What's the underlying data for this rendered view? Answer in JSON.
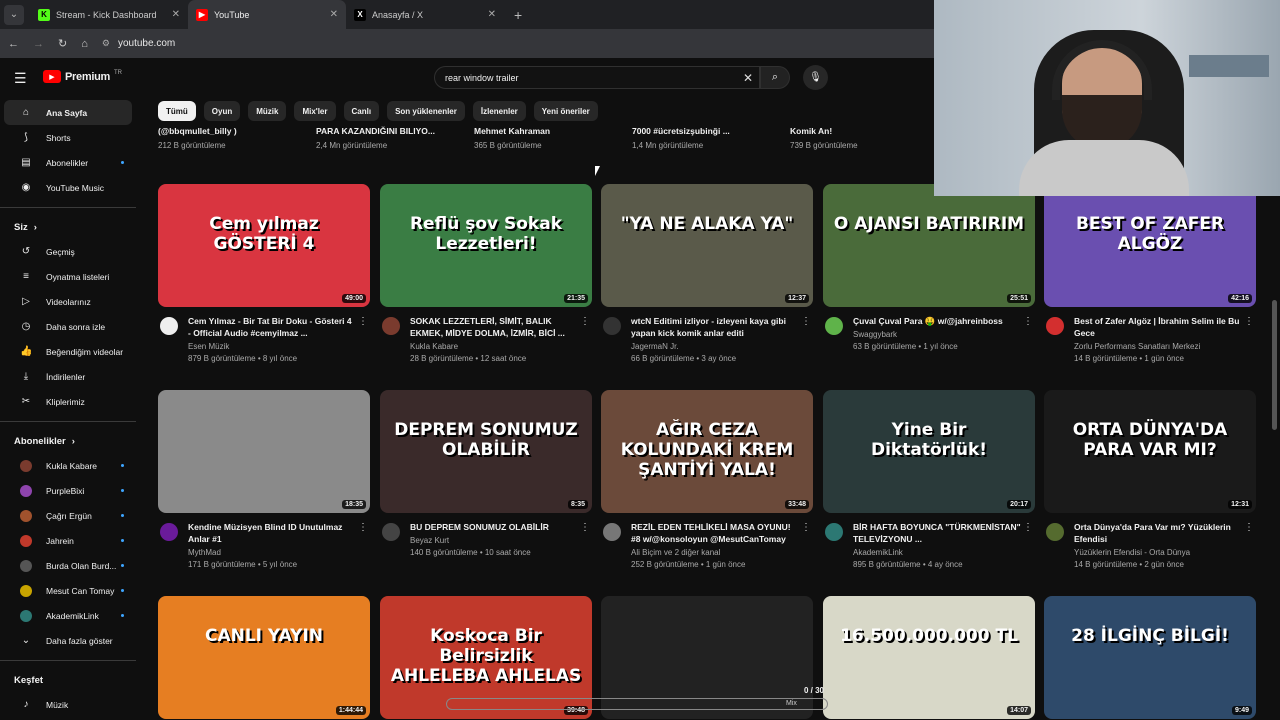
{
  "browser": {
    "tabs": [
      {
        "label": "Stream - Kick Dashboard",
        "color": "#53fc18",
        "glyph": "K"
      },
      {
        "label": "YouTube",
        "color": "#ff0000",
        "glyph": "▶"
      },
      {
        "label": "Anasayfa / X",
        "color": "#000000",
        "glyph": "X"
      }
    ],
    "new_tab": "+",
    "url": "youtube.com"
  },
  "header": {
    "logo_text": "Premium",
    "logo_region": "TR",
    "search_value": "rear window trailer",
    "search_placeholder": "Ara"
  },
  "chips": [
    "Tümü",
    "Oyun",
    "Müzik",
    "Mix'ler",
    "Canlı",
    "Son yüklenenler",
    "İzlenenler",
    "Yeni öneriler"
  ],
  "sidebar": {
    "main": [
      {
        "label": "Ana Sayfa",
        "icon": "home-icon",
        "glyph": "⌂"
      },
      {
        "label": "Shorts",
        "icon": "shorts-icon",
        "glyph": "⟆"
      },
      {
        "label": "Abonelikler",
        "icon": "subscriptions-icon",
        "glyph": "▤"
      },
      {
        "label": "YouTube Music",
        "icon": "music-icon",
        "glyph": "◉"
      }
    ],
    "you_heading": "Siz",
    "you": [
      {
        "label": "Geçmiş",
        "icon": "history-icon",
        "glyph": "↺"
      },
      {
        "label": "Oynatma listeleri",
        "icon": "playlists-icon",
        "glyph": "≡"
      },
      {
        "label": "Videolarınız",
        "icon": "your-videos-icon",
        "glyph": "▷"
      },
      {
        "label": "Daha sonra izle",
        "icon": "watch-later-icon",
        "glyph": "◷"
      },
      {
        "label": "Beğendiğim videolar",
        "icon": "liked-icon",
        "glyph": "👍"
      },
      {
        "label": "İndirilenler",
        "icon": "download-icon",
        "glyph": "⤓"
      },
      {
        "label": "Kliplerimiz",
        "icon": "clips-icon",
        "glyph": "✂"
      }
    ],
    "subs_heading": "Abonelikler",
    "subs": [
      {
        "label": "Kukla Kabare",
        "color": "#7a3b2e"
      },
      {
        "label": "PurpleBixi",
        "color": "#8e44ad"
      },
      {
        "label": "Çağrı Ergün",
        "color": "#a0522d"
      },
      {
        "label": "Jahrein",
        "color": "#c0392b"
      },
      {
        "label": "Burda Olan Burd...",
        "color": "#555"
      },
      {
        "label": "Mesut Can Tomay",
        "color": "#c8a400"
      },
      {
        "label": "AkademikLink",
        "color": "#2c7873"
      }
    ],
    "more_label": "Daha fazla göster",
    "explore_heading": "Keşfet",
    "explore": [
      {
        "label": "Müzik",
        "icon": "music-note-icon",
        "glyph": "♪"
      }
    ]
  },
  "top_row": [
    {
      "title": "(@bbqmullet_billy )",
      "views": "212 B görüntüleme"
    },
    {
      "title": "PARA KAZANDIĞINI BILIYO...",
      "views": "2,4 Mn görüntüleme"
    },
    {
      "title": "Mehmet Kahraman",
      "views": "365 B görüntüleme"
    },
    {
      "title": "7000 #ücretsizşubinği ...",
      "views": "1,4 Mn görüntüleme"
    },
    {
      "title": "Komik An!",
      "views": "739 B görüntüleme"
    }
  ],
  "videos": [
    {
      "title": "Cem Yılmaz - Bir Tat Bir Doku - Gösteri 4 - Official Audio #cemyilmaz ...",
      "channel": "Esen Müzik",
      "views": "879 B görüntüleme • 8 yıl önce",
      "duration": "49:00",
      "thumb_text": "Cem yılmaz GÖSTERİ 4",
      "bg": "#d93540",
      "avatar": "#eeeeee"
    },
    {
      "title": "SOKAK LEZZETLERİ, SİMİT, BALIK EKMEK, MİDYE DOLMA, İZMİR, BİCİ ...",
      "channel": "Kukla Kabare",
      "views": "28 B görüntüleme • 12 saat önce",
      "duration": "21:35",
      "thumb_text": "Reflü şov Sokak Lezzetleri!",
      "bg": "#3a7d44",
      "avatar": "#7a3b2e"
    },
    {
      "title": "wtcN Editimi izliyor - izleyeni kaya gibi yapan kick komik anlar editi",
      "channel": "JagermaN Jr.",
      "views": "66 B görüntüleme • 3 ay önce",
      "duration": "12:37",
      "thumb_text": "\"YA NE ALAKA YA\"",
      "bg": "#5a5a4a",
      "avatar": "#333333"
    },
    {
      "title": "Çuval Çuval Para 🤑 w/@jahreinboss",
      "channel": "Swaggybark",
      "views": "63 B görüntüleme • 1 yıl önce",
      "duration": "25:51",
      "thumb_text": "O AJANSI BATIRIRIM",
      "bg": "#4a6b3a",
      "avatar": "#5fb34a"
    },
    {
      "title": "Best of Zafer Algöz | İbrahim Selim ile Bu Gece",
      "channel": "Zorlu Performans Sanatları Merkezi",
      "views": "14 B görüntüleme • 1 gün önce",
      "duration": "42:16",
      "thumb_text": "BEST OF ZAFER ALGÖZ",
      "bg": "#6a4fb0",
      "avatar": "#d32f2f"
    },
    {
      "title": "Kendine Müzisyen Blind ID Unutulmaz Anlar #1",
      "channel": "MythMad",
      "views": "171 B görüntüleme • 5 yıl önce",
      "duration": "18:35",
      "thumb_text": "",
      "bg": "#8a8a8a",
      "avatar": "#6a1b9a"
    },
    {
      "title": "BU DEPREM SONUMUZ OLABİLİR",
      "channel": "Beyaz Kurt",
      "views": "140 B görüntüleme • 10 saat önce",
      "duration": "8:35",
      "thumb_text": "DEPREM SONUMUZ OLABİLİR",
      "bg": "#3a2a2a",
      "avatar": "#444444"
    },
    {
      "title": "REZİL EDEN TEHLİKELİ MASA OYUNU! #8 w/@konsoloyun @MesutCanTomay",
      "channel": "Ali Biçim ve 2 diğer kanal",
      "views": "252 B görüntüleme • 1 gün önce",
      "duration": "33:48",
      "thumb_text": "AĞIR CEZA KOLUNDAKİ KREM ŞANTİYİ YALA!",
      "bg": "#6b4a3a",
      "avatar": "#777777"
    },
    {
      "title": "BİR HAFTA BOYUNCA \"TÜRKMENİSTAN\" TELEVİZYONU ...",
      "channel": "AkademikLink",
      "views": "895 B görüntüleme • 4 ay önce",
      "duration": "20:17",
      "thumb_text": "Yine Bir Diktatörlük!",
      "bg": "#2a3a3a",
      "avatar": "#2c7873"
    },
    {
      "title": "Orta Dünya'da Para Var mı? Yüzüklerin Efendisi",
      "channel": "Yüzüklerin Efendisi - Orta Dünya",
      "views": "14 B görüntüleme • 2 gün önce",
      "duration": "12:31",
      "thumb_text": "ORTA DÜNYA'DA PARA VAR MI?",
      "bg": "#1a1a1a",
      "avatar": "#556b2f"
    },
    {
      "title": "",
      "channel": "",
      "views": "",
      "duration": "1:44:44",
      "thumb_text": "CANLI YAYIN",
      "bg": "#e67e22",
      "avatar": ""
    },
    {
      "title": "",
      "channel": "",
      "views": "",
      "duration": "39:48",
      "thumb_text": "Koskoca Bir Belirsizlik AHLELEBA AHLELAS",
      "bg": "#c0392b",
      "avatar": ""
    },
    {
      "title": "",
      "channel": "",
      "views": "",
      "duration": "",
      "thumb_text": "",
      "bg": "#222222",
      "avatar": ""
    },
    {
      "title": "",
      "channel": "",
      "views": "",
      "duration": "14:07",
      "thumb_text": "16.500.000.000 TL",
      "bg": "#d8d8c8",
      "avatar": ""
    },
    {
      "title": "",
      "channel": "",
      "views": "",
      "duration": "9:49",
      "thumb_text": "28 İLGİNÇ BİLGİ!",
      "bg": "#2e4a6a",
      "avatar": ""
    }
  ],
  "player": {
    "counter": "0 / 30",
    "label": "Mix"
  }
}
